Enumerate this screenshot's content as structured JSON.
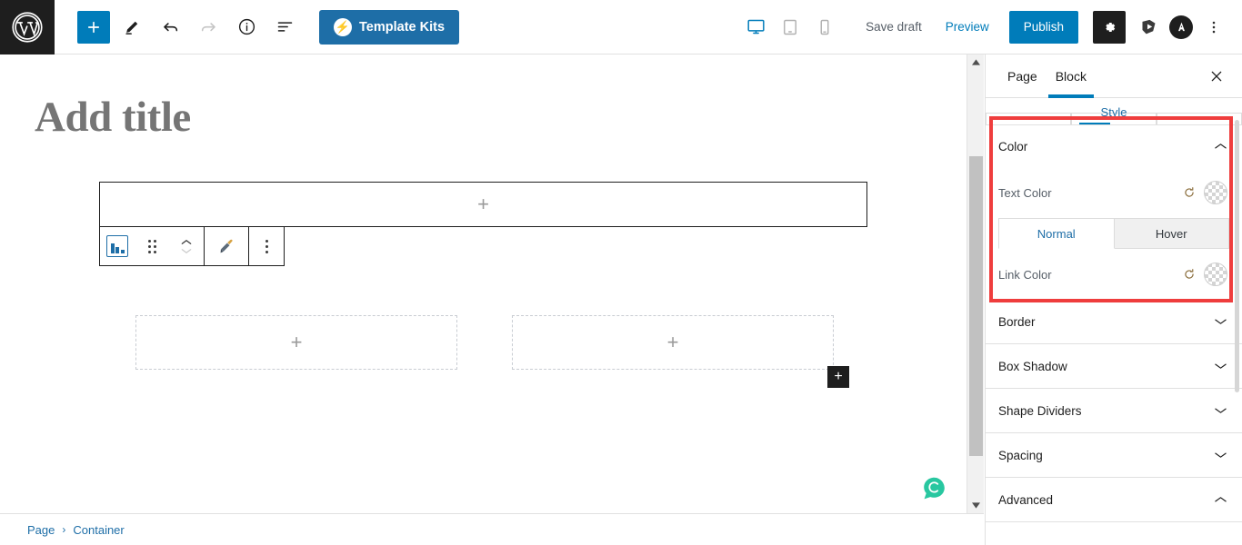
{
  "topbar": {
    "logo_icon": "wordpress-logo-icon",
    "add_block_label": "+",
    "tools": [
      {
        "name": "add-block-button",
        "icon": "plus-icon",
        "label": "+"
      },
      {
        "name": "edit-tool-button",
        "icon": "pencil-icon",
        "label": ""
      },
      {
        "name": "undo-button",
        "icon": "undo-arrow-icon",
        "label": ""
      },
      {
        "name": "redo-button",
        "icon": "redo-arrow-icon",
        "label": ""
      },
      {
        "name": "details-button",
        "icon": "info-circle-icon",
        "label": ""
      },
      {
        "name": "list-view-button",
        "icon": "list-view-icon",
        "label": ""
      }
    ],
    "template_kits_label": "Template Kits",
    "template_kits_icon": "bolt-icon",
    "devices": [
      {
        "name": "desktop-view-button",
        "icon": "desktop-icon",
        "active": true
      },
      {
        "name": "tablet-view-button",
        "icon": "tablet-icon",
        "active": false
      },
      {
        "name": "mobile-view-button",
        "icon": "mobile-icon",
        "active": false
      }
    ],
    "save_draft_label": "Save draft",
    "preview_label": "Preview",
    "publish_label": "Publish",
    "settings_icon": "gear-icon",
    "plugin_icon": "premium-addons-icon",
    "astra_icon": "astra-logo-icon",
    "more_icon": "vertical-ellipsis-icon"
  },
  "canvas": {
    "title_placeholder": "Add title",
    "container_plus": "+",
    "column_plus": "+",
    "append_plus": "+",
    "chat_icon": "chat-bubble-icon",
    "block_toolbar": {
      "block_type_icon": "container-block-icon",
      "drag_icon": "drag-handle-icon",
      "move_up_icon": "chevron-up-icon",
      "move_down_icon": "chevron-down-icon",
      "style_icon": "paint-brush-icon",
      "options_icon": "vertical-ellipsis-icon"
    }
  },
  "breadcrumb": {
    "items": [
      "Page",
      "Container"
    ],
    "separator": "›"
  },
  "sidebar": {
    "tabs": [
      {
        "label": "Page",
        "active": false
      },
      {
        "label": "Block",
        "active": true
      }
    ],
    "close_icon": "close-icon",
    "style_strip_label": "Style",
    "color_section": {
      "title": "Color",
      "toggle_icon": "chevron-up-icon",
      "text_color_label": "Text Color",
      "link_color_label": "Link Color",
      "reset_icon": "reset-icon",
      "swatch_icon": "transparent-swatch-icon",
      "state_tabs": [
        {
          "label": "Normal",
          "active": true
        },
        {
          "label": "Hover",
          "active": false
        }
      ]
    },
    "panels": [
      {
        "label": "Border",
        "expanded": false,
        "icon": "chevron-down-icon"
      },
      {
        "label": "Box Shadow",
        "expanded": false,
        "icon": "chevron-down-icon"
      },
      {
        "label": "Shape Dividers",
        "expanded": false,
        "icon": "chevron-down-icon"
      },
      {
        "label": "Spacing",
        "expanded": false,
        "icon": "chevron-down-icon"
      },
      {
        "label": "Advanced",
        "expanded": true,
        "icon": "chevron-up-icon"
      }
    ],
    "highlight_color": "#ef3d3d"
  },
  "colors": {
    "accent": "#007cba",
    "link": "#1e6ea7",
    "dark": "#1e1e1e",
    "highlight": "#ef3d3d",
    "chat": "#28c7a0"
  }
}
